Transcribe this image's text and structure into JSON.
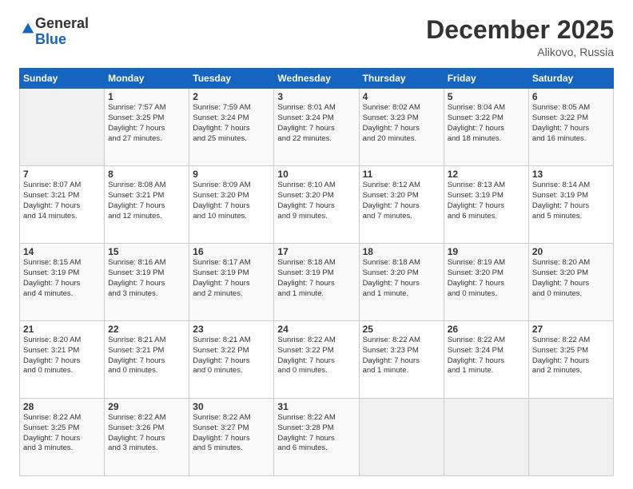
{
  "logo": {
    "general": "General",
    "blue": "Blue"
  },
  "header": {
    "month": "December 2025",
    "location": "Alikovo, Russia"
  },
  "days_of_week": [
    "Sunday",
    "Monday",
    "Tuesday",
    "Wednesday",
    "Thursday",
    "Friday",
    "Saturday"
  ],
  "weeks": [
    [
      {
        "day": "",
        "info": ""
      },
      {
        "day": "1",
        "info": "Sunrise: 7:57 AM\nSunset: 3:25 PM\nDaylight: 7 hours\nand 27 minutes."
      },
      {
        "day": "2",
        "info": "Sunrise: 7:59 AM\nSunset: 3:24 PM\nDaylight: 7 hours\nand 25 minutes."
      },
      {
        "day": "3",
        "info": "Sunrise: 8:01 AM\nSunset: 3:24 PM\nDaylight: 7 hours\nand 22 minutes."
      },
      {
        "day": "4",
        "info": "Sunrise: 8:02 AM\nSunset: 3:23 PM\nDaylight: 7 hours\nand 20 minutes."
      },
      {
        "day": "5",
        "info": "Sunrise: 8:04 AM\nSunset: 3:22 PM\nDaylight: 7 hours\nand 18 minutes."
      },
      {
        "day": "6",
        "info": "Sunrise: 8:05 AM\nSunset: 3:22 PM\nDaylight: 7 hours\nand 16 minutes."
      }
    ],
    [
      {
        "day": "7",
        "info": "Sunrise: 8:07 AM\nSunset: 3:21 PM\nDaylight: 7 hours\nand 14 minutes."
      },
      {
        "day": "8",
        "info": "Sunrise: 8:08 AM\nSunset: 3:21 PM\nDaylight: 7 hours\nand 12 minutes."
      },
      {
        "day": "9",
        "info": "Sunrise: 8:09 AM\nSunset: 3:20 PM\nDaylight: 7 hours\nand 10 minutes."
      },
      {
        "day": "10",
        "info": "Sunrise: 8:10 AM\nSunset: 3:20 PM\nDaylight: 7 hours\nand 9 minutes."
      },
      {
        "day": "11",
        "info": "Sunrise: 8:12 AM\nSunset: 3:20 PM\nDaylight: 7 hours\nand 7 minutes."
      },
      {
        "day": "12",
        "info": "Sunrise: 8:13 AM\nSunset: 3:19 PM\nDaylight: 7 hours\nand 6 minutes."
      },
      {
        "day": "13",
        "info": "Sunrise: 8:14 AM\nSunset: 3:19 PM\nDaylight: 7 hours\nand 5 minutes."
      }
    ],
    [
      {
        "day": "14",
        "info": "Sunrise: 8:15 AM\nSunset: 3:19 PM\nDaylight: 7 hours\nand 4 minutes."
      },
      {
        "day": "15",
        "info": "Sunrise: 8:16 AM\nSunset: 3:19 PM\nDaylight: 7 hours\nand 3 minutes."
      },
      {
        "day": "16",
        "info": "Sunrise: 8:17 AM\nSunset: 3:19 PM\nDaylight: 7 hours\nand 2 minutes."
      },
      {
        "day": "17",
        "info": "Sunrise: 8:18 AM\nSunset: 3:19 PM\nDaylight: 7 hours\nand 1 minute."
      },
      {
        "day": "18",
        "info": "Sunrise: 8:18 AM\nSunset: 3:20 PM\nDaylight: 7 hours\nand 1 minute."
      },
      {
        "day": "19",
        "info": "Sunrise: 8:19 AM\nSunset: 3:20 PM\nDaylight: 7 hours\nand 0 minutes."
      },
      {
        "day": "20",
        "info": "Sunrise: 8:20 AM\nSunset: 3:20 PM\nDaylight: 7 hours\nand 0 minutes."
      }
    ],
    [
      {
        "day": "21",
        "info": "Sunrise: 8:20 AM\nSunset: 3:21 PM\nDaylight: 7 hours\nand 0 minutes."
      },
      {
        "day": "22",
        "info": "Sunrise: 8:21 AM\nSunset: 3:21 PM\nDaylight: 7 hours\nand 0 minutes."
      },
      {
        "day": "23",
        "info": "Sunrise: 8:21 AM\nSunset: 3:22 PM\nDaylight: 7 hours\nand 0 minutes."
      },
      {
        "day": "24",
        "info": "Sunrise: 8:22 AM\nSunset: 3:22 PM\nDaylight: 7 hours\nand 0 minutes."
      },
      {
        "day": "25",
        "info": "Sunrise: 8:22 AM\nSunset: 3:23 PM\nDaylight: 7 hours\nand 1 minute."
      },
      {
        "day": "26",
        "info": "Sunrise: 8:22 AM\nSunset: 3:24 PM\nDaylight: 7 hours\nand 1 minute."
      },
      {
        "day": "27",
        "info": "Sunrise: 8:22 AM\nSunset: 3:25 PM\nDaylight: 7 hours\nand 2 minutes."
      }
    ],
    [
      {
        "day": "28",
        "info": "Sunrise: 8:22 AM\nSunset: 3:25 PM\nDaylight: 7 hours\nand 3 minutes."
      },
      {
        "day": "29",
        "info": "Sunrise: 8:22 AM\nSunset: 3:26 PM\nDaylight: 7 hours\nand 3 minutes."
      },
      {
        "day": "30",
        "info": "Sunrise: 8:22 AM\nSunset: 3:27 PM\nDaylight: 7 hours\nand 5 minutes."
      },
      {
        "day": "31",
        "info": "Sunrise: 8:22 AM\nSunset: 3:28 PM\nDaylight: 7 hours\nand 6 minutes."
      },
      {
        "day": "",
        "info": ""
      },
      {
        "day": "",
        "info": ""
      },
      {
        "day": "",
        "info": ""
      }
    ]
  ]
}
